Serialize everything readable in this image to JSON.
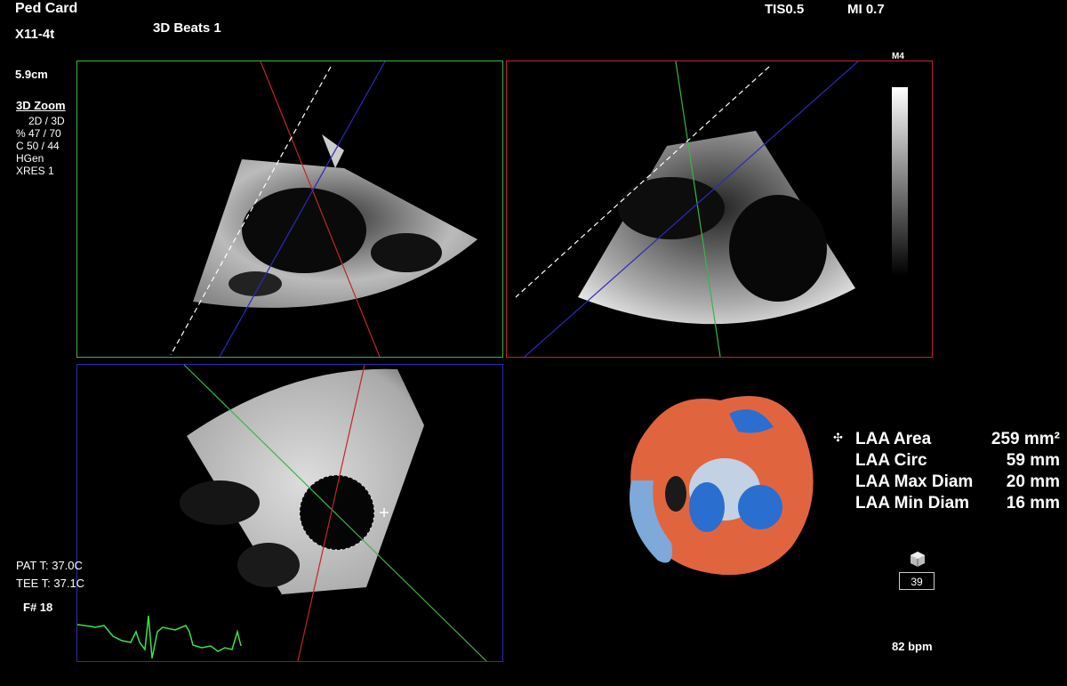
{
  "header": {
    "preset": "Ped Card",
    "probe": "X11-4t",
    "mode": "3D Beats 1",
    "tis": "TIS0.5",
    "mi": "MI 0.7",
    "map": "M4"
  },
  "settings": {
    "depth": "5.9cm",
    "zoom_title": "3D Zoom",
    "lines": [
      "2D / 3D",
      "% 47 / 70",
      "C  50 / 44",
      "HGen",
      "XRES 1"
    ]
  },
  "temps": {
    "pat": "PAT T: 37.0C",
    "tee": "TEE T: 37.1C"
  },
  "frame": {
    "label": "F# 18",
    "counter": "39"
  },
  "heart_rate": "82 bpm",
  "measurements": [
    {
      "label": "LAA Area",
      "value": "259 mm²"
    },
    {
      "label": "LAA Circ",
      "value": "59 mm"
    },
    {
      "label": "LAA Max Diam",
      "value": "20 mm"
    },
    {
      "label": "LAA Min Diam",
      "value": "16 mm"
    }
  ],
  "colors": {
    "panel_green": "#3bb34a",
    "panel_red": "#c0262d",
    "panel_blue": "#2b2bb8",
    "ecg": "#3fe04a",
    "render_orange": "#e0653e",
    "render_blue": "#2a6fd0"
  }
}
